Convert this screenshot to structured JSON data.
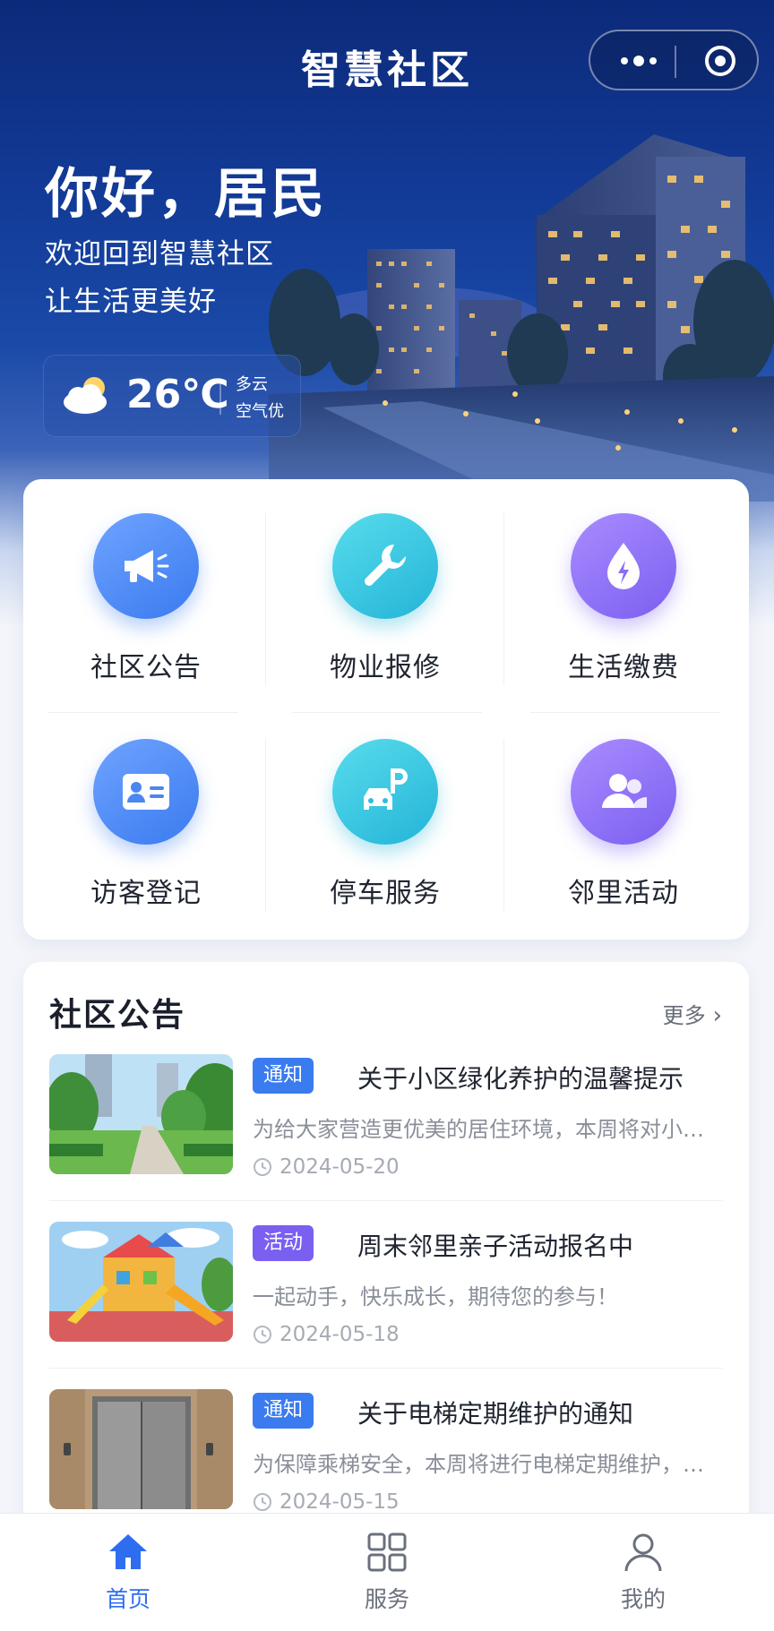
{
  "app": {
    "title": "智慧社区"
  },
  "hero": {
    "greeting": "你好，居民",
    "subtitle_line1": "欢迎回到智慧社区",
    "subtitle_line2": "让生活更美好"
  },
  "weather": {
    "icon": "cloud-sun-icon",
    "temperature": "26℃",
    "condition": "多云",
    "air_quality": "空气优"
  },
  "services": [
    {
      "label": "社区公告",
      "icon": "megaphone-icon",
      "color": "#3a7bf0"
    },
    {
      "label": "物业报修",
      "icon": "wrench-icon",
      "color": "#24b4d8"
    },
    {
      "label": "生活缴费",
      "icon": "water-drop-bolt-icon",
      "color": "#7b5ff0"
    },
    {
      "label": "访客登记",
      "icon": "id-card-icon",
      "color": "#3a7bf0"
    },
    {
      "label": "停车服务",
      "icon": "car-parking-icon",
      "color": "#24b4d8"
    },
    {
      "label": "邻里活动",
      "icon": "people-icon",
      "color": "#7b5ff0"
    }
  ],
  "announcements": {
    "title": "社区公告",
    "more_label": "更多",
    "items": [
      {
        "tag": "通知",
        "tag_color": "#3a7bf0",
        "title": "关于小区绿化养护的温馨提示",
        "desc": "为给大家营造更优美的居住环境，本周将对小区绿化进行养护修剪",
        "date": "2024-05-20",
        "thumb": "park-path-image"
      },
      {
        "tag": "活动",
        "tag_color": "#7b5ff0",
        "title": "周末邻里亲子活动报名中",
        "desc": "一起动手，快乐成长，期待您的参与！",
        "date": "2024-05-18",
        "thumb": "playground-image"
      },
      {
        "tag": "通知",
        "tag_color": "#3a7bf0",
        "title": "关于电梯定期维护的通知",
        "desc": "为保障乘梯安全，本周将进行电梯定期维护，期间请大家合理安排出行",
        "date": "2024-05-15",
        "thumb": "elevator-image"
      }
    ]
  },
  "tabbar": [
    {
      "label": "首页",
      "icon": "home-icon",
      "active": true
    },
    {
      "label": "服务",
      "icon": "grid-icon",
      "active": false
    },
    {
      "label": "我的",
      "icon": "user-icon",
      "active": false
    }
  ],
  "colors": {
    "primary": "#2e6df0",
    "hero_dark": "#0c2a7a"
  }
}
